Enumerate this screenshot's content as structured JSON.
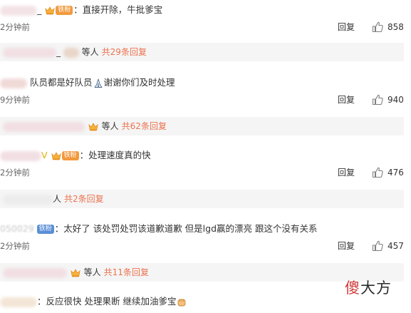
{
  "colors": {
    "accent": "#eb7350",
    "reply_bar": "#f5f5f5",
    "fan_badge": "#f29a3e",
    "muted": "#666666"
  },
  "icons": {
    "like": "thumbs-up-icon",
    "crown": "crown-icon",
    "pray": "pray-emoji",
    "fist": "fist-emoji"
  },
  "comments": [
    {
      "user_partial": "_",
      "badge": "铁粉",
      "text": "直接开除，牛批爹宝",
      "time": "2分钟前",
      "reply": "回复",
      "likes": "858",
      "sub": {
        "users_partial": "_",
        "suffix": "等人",
        "count": "共29条回复"
      }
    },
    {
      "text": "队员都是好队员",
      "text2": "谢谢你们及时处理",
      "time": "9分钟前",
      "reply": "回复",
      "likes": "940",
      "sub": {
        "suffix": "等人",
        "count": "共62条回复"
      }
    },
    {
      "user_partial": "V",
      "badge": "铁粉",
      "text": "处理速度真的快",
      "time": "2分钟前",
      "reply": "回复",
      "likes": "476",
      "sub": {
        "suffix": "人",
        "count": "共2条回复"
      }
    },
    {
      "user_partial": "050029",
      "badge": "铁粉",
      "text": "太好了 该处罚处罚该道歉道歉 但是lgd赢的漂亮 跟这个没有关系",
      "time": "2分钟前",
      "reply": "回复",
      "likes": "457",
      "sub": {
        "suffix": "等人",
        "count": "共11条回复"
      }
    },
    {
      "text": "反应很快 处理果断 继续加油爹宝"
    }
  ],
  "watermark": {
    "part1": "傻",
    "part2": "大方"
  }
}
